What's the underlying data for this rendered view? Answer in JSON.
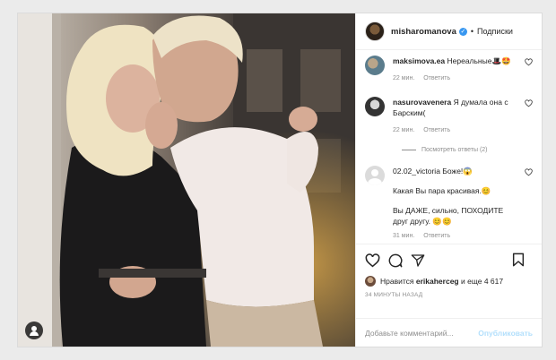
{
  "post": {
    "author": "misharomanova",
    "follow_label": "Подписки",
    "separator": "•"
  },
  "comments": [
    {
      "user": "maksimova.ea",
      "text": "Нереальные🎩🤩",
      "time": "22 мин.",
      "reply": "Ответить"
    },
    {
      "user": "nasurovavenera",
      "text": "Я думала она с Барским(",
      "time": "22 мин.",
      "reply": "Ответить",
      "view_replies": "Посмотреть ответы (2)"
    },
    {
      "user": "02.02_victoria",
      "text": "Боже!😱",
      "text2": "Какая Вы пара красивая.😊",
      "text3": "Вы ДАЖЕ, сильно, ПОХОДИТЕ друг другу. 😊😊",
      "time": "31 мин.",
      "reply": "Ответить"
    }
  ],
  "likes": {
    "prefix": "Нравится",
    "user": "erikaherceg",
    "suffix": "и еще 4 617"
  },
  "timestamp": "34 МИНУТЫ НАЗАД",
  "comment_box": {
    "placeholder": "Добавьте комментарий...",
    "publish_label": "Опубликовать"
  },
  "icons": [
    "heart-icon",
    "comment-icon",
    "share-icon",
    "bookmark-icon",
    "user-tag-icon",
    "verified-icon"
  ],
  "colors": {
    "verified": "#3897f0",
    "publish_disabled": "#b2dffc",
    "meta": "#8e8e8e"
  }
}
